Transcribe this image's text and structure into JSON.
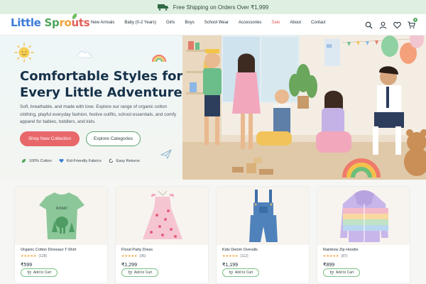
{
  "promo": {
    "text": "Free Shipping on Orders Over ₹1,999",
    "icon": "truck-icon"
  },
  "header": {
    "logo_parts": [
      "Little ",
      "Sp",
      "ro",
      "uts"
    ],
    "nav": [
      {
        "label": "New Arrivals",
        "name": "nav-new-arrivals"
      },
      {
        "label": "Baby (0-2 Years)",
        "name": "nav-baby"
      },
      {
        "label": "Girls",
        "name": "nav-girls"
      },
      {
        "label": "Boys",
        "name": "nav-boys"
      },
      {
        "label": "School Wear",
        "name": "nav-school-wear"
      },
      {
        "label": "Accessories",
        "name": "nav-accessories"
      },
      {
        "label": "Sale",
        "name": "nav-sale"
      },
      {
        "label": "About",
        "name": "nav-about"
      },
      {
        "label": "Contact",
        "name": "nav-contact"
      }
    ],
    "cart_count": "0",
    "icons": [
      "search-icon",
      "user-icon",
      "heart-icon",
      "cart-icon"
    ]
  },
  "hero": {
    "title": "Comfortable Styles for Every Little Adventure",
    "subtitle": "Soft, breathable, and made with love. Explore our range of organic cotton clothing, playful everyday fashion, festive outfits, school essentials, and comfy apparel for babies, toddlers, and kids.",
    "primary_cta": "Shop New Collection",
    "secondary_cta": "Explore Categories",
    "features": [
      "100% Cotton",
      "Kid-Friendly Fabrics",
      "Easy Returns"
    ]
  },
  "products": [
    {
      "name": "Organic Cotton Dinosaur T-Shirt",
      "stars": "★★★★★",
      "reviews": "(128)",
      "price": "₹599",
      "add": "Add to Cart",
      "rating": 4.5,
      "print": "ROAR!"
    },
    {
      "name": "Floral Party Dress",
      "stars": "★★★★★",
      "reviews": "(96)",
      "price": "₹1,299",
      "add": "Add to Cart",
      "rating": 4.5
    },
    {
      "name": "Kids Denim Overalls",
      "stars": "★★★★★",
      "reviews": "(112)",
      "price": "₹1,199",
      "add": "Add to Cart",
      "rating": 4.5
    },
    {
      "name": "Rainbow Zip Hoodie",
      "stars": "★★★★★",
      "reviews": "(87)",
      "price": "₹899",
      "add": "Add to Cart",
      "rating": 4.5
    }
  ],
  "colors": {
    "primary": "#e8676b",
    "green": "#4fa55a",
    "navy": "#16324a",
    "promo_bg": "#dff0e2"
  }
}
